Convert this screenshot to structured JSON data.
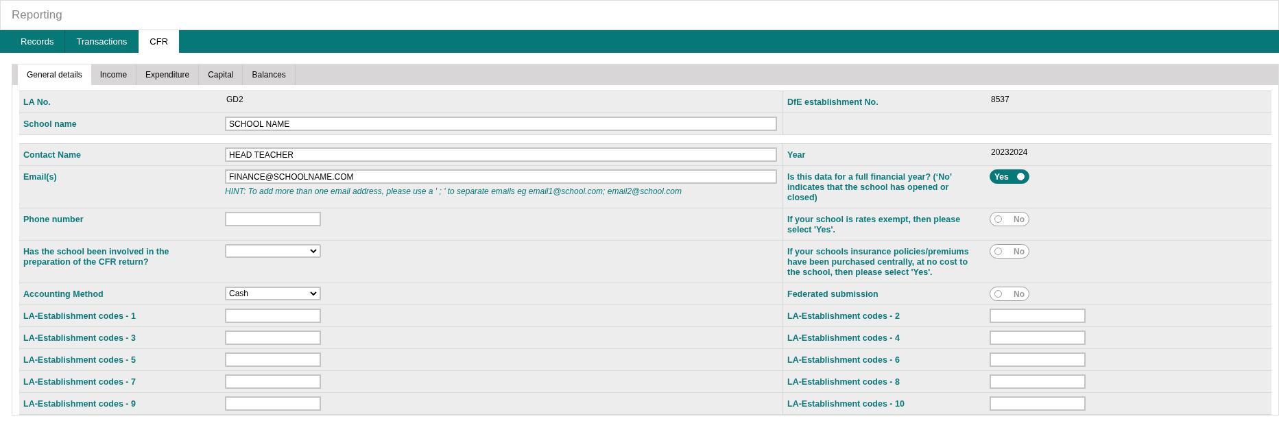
{
  "header": {
    "title": "Reporting"
  },
  "nav_tabs": [
    {
      "label": "Records",
      "selected": false
    },
    {
      "label": "Transactions",
      "selected": false
    },
    {
      "label": "CFR",
      "selected": true
    }
  ],
  "sub_tabs": [
    {
      "label": "General details",
      "selected": true
    },
    {
      "label": "Income",
      "selected": false
    },
    {
      "label": "Expenditure",
      "selected": false
    },
    {
      "label": "Capital",
      "selected": false
    },
    {
      "label": "Balances",
      "selected": false
    }
  ],
  "sections": [
    {
      "rows": [
        {
          "left": {
            "label": "LA No.",
            "kind": "text",
            "value": "GD2"
          },
          "right": {
            "label": "DfE establishment No.",
            "kind": "text",
            "value": "8537"
          }
        },
        {
          "left": {
            "label": "School name",
            "kind": "wide_input",
            "value": "SCHOOL NAME"
          }
        }
      ]
    },
    {
      "rows": [
        {
          "left": {
            "label": "Contact Name",
            "kind": "wide_input",
            "value": "HEAD TEACHER"
          },
          "right": {
            "label": "Year",
            "kind": "text",
            "value": "20232024"
          }
        },
        {
          "left": {
            "label": "Email(s)",
            "kind": "wide_input",
            "value": "FINANCE@SCHOOLNAME.COM",
            "hint": "HINT: To add more than one email address, please use a ' ; ' to separate emails eg email1@school.com; email2@school.com"
          },
          "right": {
            "label": "Is this data for a full financial year? (‘No’ indicates that the school has opened or closed)",
            "kind": "toggle",
            "value": "Yes",
            "on": true
          }
        },
        {
          "left": {
            "label": "Phone number",
            "kind": "input"
          },
          "right": {
            "label": "If your school is rates exempt, then please select 'Yes'.",
            "kind": "toggle",
            "value": "No",
            "on": false
          }
        },
        {
          "left": {
            "label": "Has the school been involved in the preparation of the CFR return?",
            "kind": "select"
          },
          "right": {
            "label": "If your schools insurance policies/premiums have been purchased centrally, at no cost to the school, then please select 'Yes'.",
            "kind": "toggle",
            "value": "No",
            "on": false
          }
        },
        {
          "left": {
            "label": "Accounting Method",
            "kind": "select",
            "value": "Cash"
          },
          "right": {
            "label": "Federated submission",
            "kind": "toggle",
            "value": "No",
            "on": false
          }
        },
        {
          "left": {
            "label": "LA-Establishment codes - 1",
            "kind": "input"
          },
          "right": {
            "label": "LA-Establishment codes - 2",
            "kind": "input"
          }
        },
        {
          "left": {
            "label": "LA-Establishment codes - 3",
            "kind": "input"
          },
          "right": {
            "label": "LA-Establishment codes - 4",
            "kind": "input"
          }
        },
        {
          "left": {
            "label": "LA-Establishment codes - 5",
            "kind": "input"
          },
          "right": {
            "label": "LA-Establishment codes - 6",
            "kind": "input"
          }
        },
        {
          "left": {
            "label": "LA-Establishment codes - 7",
            "kind": "input"
          },
          "right": {
            "label": "LA-Establishment codes - 8",
            "kind": "input"
          }
        },
        {
          "left": {
            "label": "LA-Establishment codes - 9",
            "kind": "input"
          },
          "right": {
            "label": "LA-Establishment codes - 10",
            "kind": "input"
          }
        }
      ]
    }
  ]
}
